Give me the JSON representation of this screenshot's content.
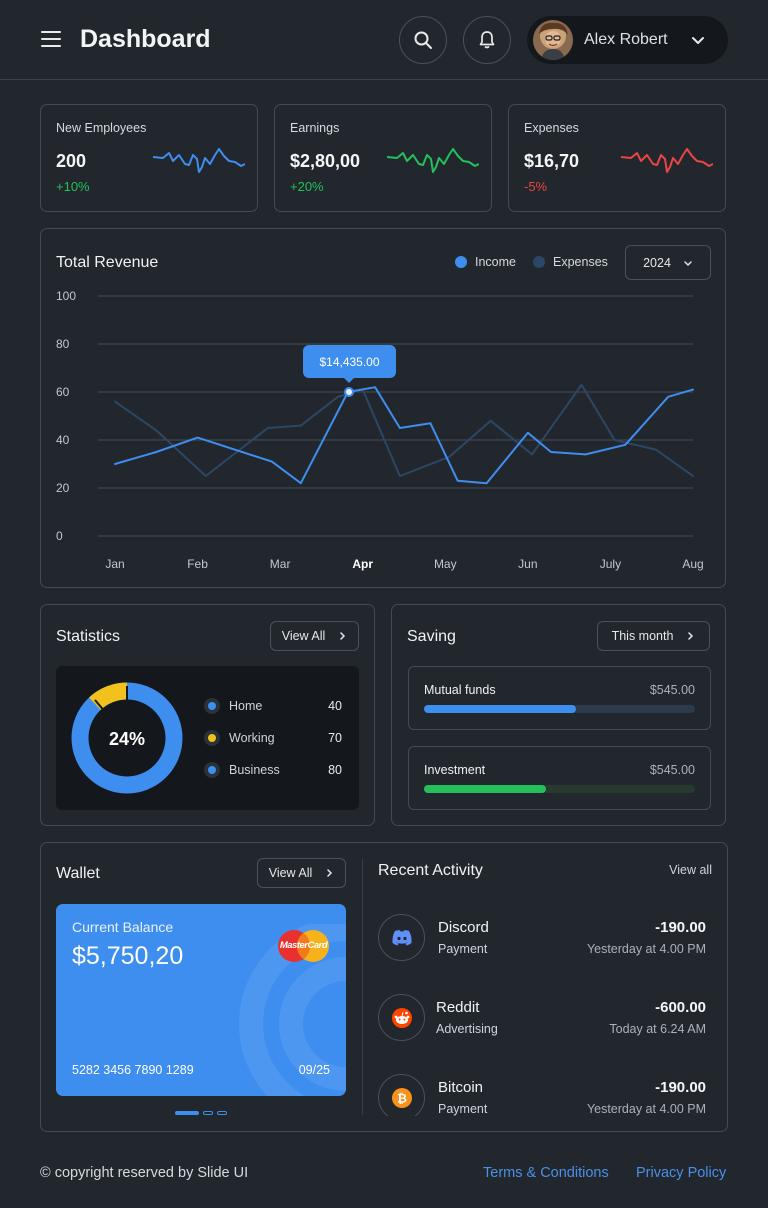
{
  "header": {
    "title": "Dashboard",
    "user_name": "Alex Robert"
  },
  "stat_cards": [
    {
      "label": "New Employees",
      "value": "200",
      "delta": "+10%",
      "color": "#3e8ef0"
    },
    {
      "label": "Earnings",
      "value": "$2,80,00",
      "delta": "+20%",
      "color": "#23c05b"
    },
    {
      "label": "Expenses",
      "value": "$16,70",
      "delta": "-5%",
      "color": "#e84545"
    }
  ],
  "revenue": {
    "title": "Total Revenue",
    "legend_income": "Income",
    "legend_expenses": "Expenses",
    "year": "2024",
    "tooltip": "$14,435.00"
  },
  "chart_data": {
    "type": "line",
    "categories": [
      "Jan",
      "Feb",
      "Mar",
      "Apr",
      "May",
      "Jun",
      "July",
      "Aug"
    ],
    "y_ticks": [
      100,
      80,
      60,
      40,
      20,
      0
    ],
    "ylim": [
      0,
      100
    ],
    "active_category": "Apr",
    "series": [
      {
        "name": "Income",
        "color": "#3e8ef0",
        "x": [
          0,
          0.5,
          1.0,
          1.9,
          2.25,
          2.82,
          3.15,
          3.45,
          3.82,
          4.15,
          4.5,
          5.0,
          5.28,
          5.7,
          6.18,
          6.7,
          7.0
        ],
        "y": [
          30,
          35,
          41,
          31,
          22,
          60,
          62,
          45,
          47,
          23,
          22,
          43,
          35,
          34,
          38,
          58,
          61
        ]
      },
      {
        "name": "Expenses",
        "color": "#2c4766",
        "x": [
          0,
          0.5,
          1.1,
          1.85,
          2.25,
          2.7,
          3.0,
          3.45,
          4.05,
          4.55,
          5.05,
          5.65,
          6.05,
          6.55,
          7.0
        ],
        "y": [
          56,
          44,
          25,
          45,
          46,
          58,
          61,
          25,
          33,
          48,
          34,
          63,
          40,
          36,
          25
        ]
      }
    ]
  },
  "statistics": {
    "title": "Statistics",
    "view_all": "View All",
    "center_label": "24%",
    "percent": 24,
    "items": [
      {
        "label": "Home",
        "value": "40",
        "color": "#3e8ef0"
      },
      {
        "label": "Working",
        "value": "70",
        "color": "#f1c21b"
      },
      {
        "label": "Business",
        "value": "80",
        "color": "#3e8ef0"
      }
    ]
  },
  "saving": {
    "title": "Saving",
    "period": "This month",
    "items": [
      {
        "label": "Mutual funds",
        "amount": "$545.00",
        "progress": 0.56,
        "color": "#3e8ef0",
        "track": "#2c3a4c"
      },
      {
        "label": "Investment",
        "amount": "$545.00",
        "progress": 0.45,
        "color": "#23c05b",
        "track": "#263a30"
      }
    ]
  },
  "wallet": {
    "title": "Wallet",
    "view_all": "View All",
    "card_label": "Current Balance",
    "balance": "$5,750,20",
    "card_number": "5282 3456 7890 1289",
    "expiry": "09/25",
    "brand": "MasterCard"
  },
  "activity": {
    "title": "Recent Activity",
    "view_all": "View all",
    "items": [
      {
        "name": "Discord",
        "sub": "Payment",
        "amount": "-190.00",
        "time": "Yesterday at 4.00 PM",
        "icon": "discord-icon"
      },
      {
        "name": "Reddit",
        "sub": "Advertising",
        "amount": "-600.00",
        "time": "Today at 6.24 AM",
        "icon": "reddit-icon"
      },
      {
        "name": "Bitcoin",
        "sub": "Payment",
        "amount": "-190.00",
        "time": "Yesterday at 4.00 PM",
        "icon": "bitcoin-icon"
      }
    ]
  },
  "footer": {
    "copyright": "© copyright reserved by Slide UI",
    "terms": "Terms & Conditions",
    "privacy": "Privacy Policy"
  }
}
